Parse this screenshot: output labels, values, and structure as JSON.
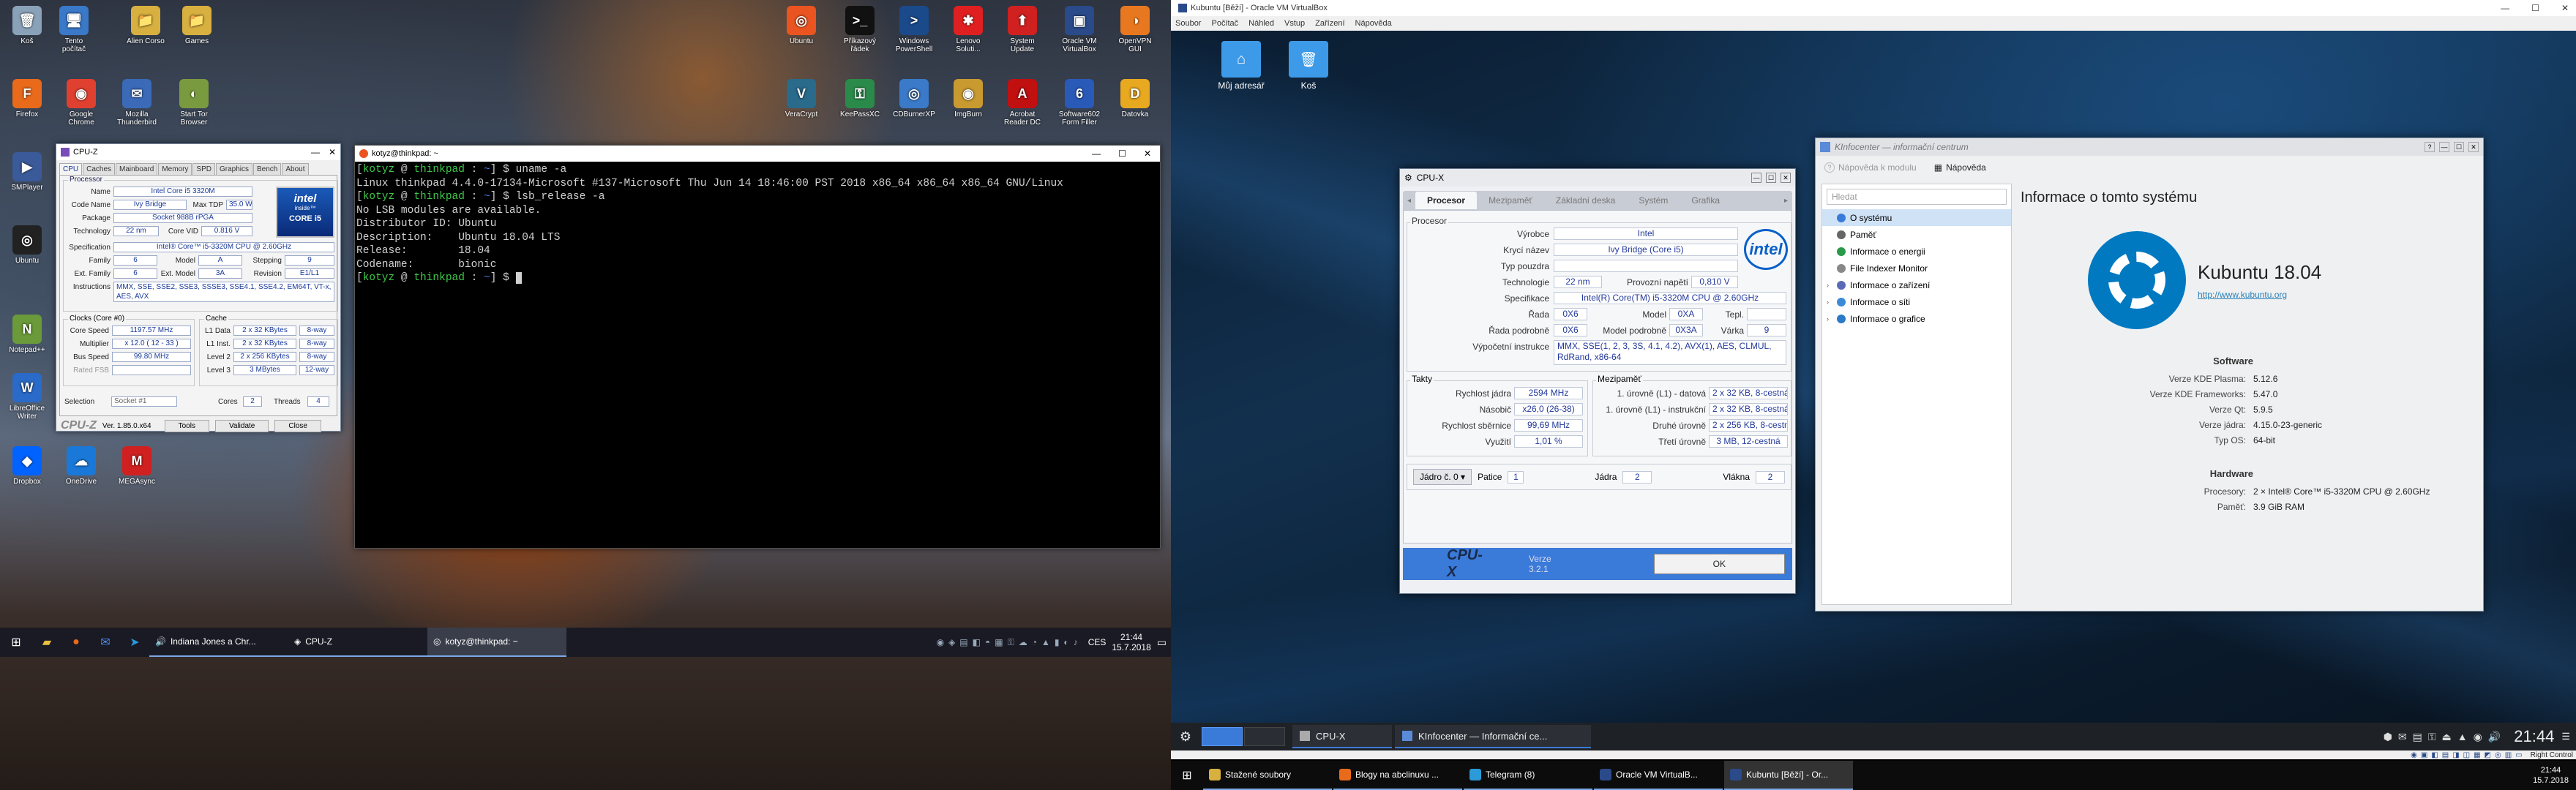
{
  "desktop_left": {
    "icons": [
      {
        "id": "kos",
        "label": "Koš",
        "color": "#8aa2b8",
        "glyph": "🗑"
      },
      {
        "id": "pc",
        "label": "Tento počítač",
        "color": "#3a78c8",
        "glyph": "🖥"
      },
      {
        "id": "alien",
        "label": "Alien Corso",
        "color": "#d8b040",
        "glyph": "📁"
      },
      {
        "id": "games",
        "label": "Games",
        "color": "#d8b040",
        "glyph": "📁"
      },
      {
        "id": "firefox",
        "label": "Firefox",
        "color": "#e86a1a",
        "glyph": "F"
      },
      {
        "id": "chrome",
        "label": "Google Chrome",
        "color": "#e04030",
        "glyph": "◉"
      },
      {
        "id": "tbird",
        "label": "Mozilla Thunderbird",
        "color": "#3a6ab8",
        "glyph": "✉"
      },
      {
        "id": "tor",
        "label": "Start Tor Browser",
        "color": "#7a9a40",
        "glyph": "◐"
      },
      {
        "id": "smp",
        "label": "SMPlayer",
        "color": "#3a5a9a",
        "glyph": "▶"
      },
      {
        "id": "ubuntu1",
        "label": "Ubuntu",
        "color": "#222",
        "glyph": "◎"
      },
      {
        "id": "notepad",
        "label": "Notepad++",
        "color": "#6a9a3a",
        "glyph": "N"
      },
      {
        "id": "libre",
        "label": "LibreOffice Writer",
        "color": "#2a6ac8",
        "glyph": "W"
      },
      {
        "id": "dropbox",
        "label": "Dropbox",
        "color": "#0062ff",
        "glyph": "◆"
      },
      {
        "id": "onedrive",
        "label": "OneDrive",
        "color": "#1a78d8",
        "glyph": "☁"
      },
      {
        "id": "mega",
        "label": "MEGAsync",
        "color": "#d02020",
        "glyph": "M"
      },
      {
        "id": "ubuntu2",
        "label": "Ubuntu",
        "color": "#e95420",
        "glyph": "◎"
      },
      {
        "id": "cmd",
        "label": "Příkazový řádek",
        "color": "#111",
        "glyph": ">_"
      },
      {
        "id": "pwsh",
        "label": "Windows PowerShell",
        "color": "#1a4a8a",
        "glyph": ">"
      },
      {
        "id": "lenovo",
        "label": "Lenovo Soluti...",
        "color": "#e02020",
        "glyph": "✱"
      },
      {
        "id": "sysup",
        "label": "System Update",
        "color": "#d02020",
        "glyph": "⬆"
      },
      {
        "id": "vbox",
        "label": "Oracle VM VirtualBox",
        "color": "#2a4a8a",
        "glyph": "▣"
      },
      {
        "id": "ovpn",
        "label": "OpenVPN GUI",
        "color": "#e87820",
        "glyph": "◑"
      },
      {
        "id": "veracrypt",
        "label": "VeraCrypt",
        "color": "#2a6a8a",
        "glyph": "V"
      },
      {
        "id": "keepass",
        "label": "KeePassXC",
        "color": "#2a8a4a",
        "glyph": "⚿"
      },
      {
        "id": "cdburner",
        "label": "CDBurnerXP",
        "color": "#3a7ac8",
        "glyph": "◎"
      },
      {
        "id": "imgburn",
        "label": "ImgBurn",
        "color": "#c89a30",
        "glyph": "◉"
      },
      {
        "id": "acrobat",
        "label": "Acrobat Reader DC",
        "color": "#c01010",
        "glyph": "A"
      },
      {
        "id": "s602",
        "label": "Software602 Form Filler",
        "color": "#2a5ab8",
        "glyph": "6"
      },
      {
        "id": "datovka",
        "label": "Datovka",
        "color": "#e8a820",
        "glyph": "D"
      }
    ],
    "taskbar": {
      "items": [
        {
          "label": "Indiana Jones a Chr...",
          "glyph": "🔊"
        },
        {
          "label": "CPU-Z",
          "glyph": "◈"
        },
        {
          "label": "kotyz@thinkpad: ~",
          "glyph": "◎"
        }
      ],
      "lang": "CES",
      "time": "21:44",
      "date": "15.7.2018"
    }
  },
  "cpuz_win": {
    "title": "CPU-Z",
    "tabs": [
      "CPU",
      "Caches",
      "Mainboard",
      "Memory",
      "SPD",
      "Graphics",
      "Bench",
      "About"
    ],
    "group_processor": "Processor",
    "name_lbl": "Name",
    "name": "Intel Core i5 3320M",
    "codename_lbl": "Code Name",
    "codename": "Ivy Bridge",
    "maxtdp_lbl": "Max TDP",
    "maxtdp": "35.0 W",
    "package_lbl": "Package",
    "package": "Socket 988B rPGA",
    "tech_lbl": "Technology",
    "tech": "22 nm",
    "corevid_lbl": "Core VID",
    "corevid": "0.816 V",
    "spec_lbl": "Specification",
    "spec": "Intel® Core™ i5-3320M CPU @ 2.60GHz",
    "family_lbl": "Family",
    "family": "6",
    "model_lbl": "Model",
    "model": "A",
    "stepping_lbl": "Stepping",
    "stepping": "9",
    "extfam_lbl": "Ext. Family",
    "extfam": "6",
    "extmodel_lbl": "Ext. Model",
    "extmodel": "3A",
    "rev_lbl": "Revision",
    "rev": "E1/L1",
    "instr_lbl": "Instructions",
    "instr": "MMX, SSE, SSE2, SSE3, SSSE3, SSE4.1, SSE4.2, EM64T, VT-x, AES, AVX",
    "clocks_title": "Clocks (Core #0)",
    "corespeed_lbl": "Core Speed",
    "corespeed": "1197.57 MHz",
    "mult_lbl": "Multiplier",
    "mult": "x 12.0 ( 12 - 33 )",
    "bus_lbl": "Bus Speed",
    "bus": "99.80 MHz",
    "fsb_lbl": "Rated FSB",
    "fsb": "",
    "cache_title": "Cache",
    "l1d_lbl": "L1 Data",
    "l1d": "2 x 32 KBytes",
    "l1d_w": "8-way",
    "l1i_lbl": "L1 Inst.",
    "l1i": "2 x 32 KBytes",
    "l1i_w": "8-way",
    "l2_lbl": "Level 2",
    "l2": "2 x 256 KBytes",
    "l2_w": "8-way",
    "l3_lbl": "Level 3",
    "l3": "3 MBytes",
    "l3_w": "12-way",
    "sel_lbl": "Selection",
    "sel": "Socket #1",
    "cores_lbl": "Cores",
    "cores": "2",
    "threads_lbl": "Threads",
    "threads": "4",
    "brand": "CPU-Z",
    "ver": "Ver. 1.85.0.x64",
    "tools": "Tools",
    "validate": "Validate",
    "close": "Close",
    "logo_intel": "intel",
    "logo_inside": "inside™",
    "logo_core": "CORE i5"
  },
  "terminal": {
    "title": "kotyz@thinkpad: ~",
    "user": "kotyz",
    "at": " @ ",
    "host": "thinkpad",
    "sep": " : ",
    "dir": "~",
    "prompt_end": "] $ ",
    "cmd1": "uname -a",
    "out1": "Linux thinkpad 4.4.0-17134-Microsoft #137-Microsoft Thu Jun 14 18:46:00 PST 2018 x86_64 x86_64 x86_64 GNU/Linux",
    "cmd2": "lsb_release -a",
    "out2": "No LSB modules are available.",
    "out3": "Distributor ID: Ubuntu",
    "out4": "Description:    Ubuntu 18.04 LTS",
    "out5": "Release:        18.04",
    "out6": "Codename:       bionic"
  },
  "vbox": {
    "title": "Kubuntu [Běží] - Oracle VM VirtualBox",
    "menu": [
      "Soubor",
      "Počítač",
      "Náhled",
      "Vstup",
      "Zařízení",
      "Nápověda"
    ]
  },
  "kde_desktop": {
    "icons": [
      {
        "label": "Můj adresář"
      },
      {
        "label": "Koš"
      }
    ]
  },
  "kcpux": {
    "title": "CPU-X",
    "tabs": [
      "Procesor",
      "Mezipaměť",
      "Základní deska",
      "Systém",
      "Grafika"
    ],
    "group_proc": "Procesor",
    "vyrobce_lbl": "Výrobce",
    "vyrobce": "Intel",
    "kryci_lbl": "Krycí název",
    "kryci": "Ivy Bridge (Core i5)",
    "typ_lbl": "Typ pouzdra",
    "typ": "",
    "tech_lbl": "Technologie",
    "tech": "22 nm",
    "napeti_lbl": "Provozní napětí",
    "napeti": "0,810 V",
    "spec_lbl": "Specifikace",
    "spec": "Intel(R) Core(TM) i5-3320M CPU @ 2.60GHz",
    "rada_lbl": "Řada",
    "rada": "0X6",
    "model_lbl": "Model",
    "model": "0XA",
    "tepl_lbl": "Tepl.",
    "tepl": "",
    "radap_lbl": "Řada podrobně",
    "radap": "0X6",
    "modelp_lbl": "Model podrobně",
    "modelp": "0X3A",
    "varka_lbl": "Várka",
    "varka": "9",
    "instr_lbl": "Výpočetní instrukce",
    "instr": "MMX, SSE(1, 2, 3, 3S, 4.1, 4.2), AVX(1), AES, CLMUL, RdRand, x86-64",
    "group_takty": "Takty",
    "rychlost_lbl": "Rychlost jádra",
    "rychlost": "2594 MHz",
    "nasobic_lbl": "Násobič",
    "nasobic": "x26,0 (26-38)",
    "sbernice_lbl": "Rychlost sběrnice",
    "sbernice": "99,69 MHz",
    "vyuziti_lbl": "Využití",
    "vyuziti": "1,01 %",
    "group_cache": "Mezipaměť",
    "l1d_lbl": "1. úrovně (L1) - datová",
    "l1d": "2 x 32 KB, 8-cestná",
    "l1i_lbl": "1. úrovně (L1) - instrukční",
    "l1i": "2 x 32 KB, 8-cestná",
    "l2_lbl": "Druhé úrovně",
    "l2": "2 x 256 KB, 8-cestná",
    "l3_lbl": "Třetí úrovně",
    "l3": "3 MB, 12-cestná",
    "core_sel": "Jádro č. 0",
    "patice_lbl": "Patice",
    "patice": "1",
    "jadra_lbl": "Jádra",
    "jadra": "2",
    "vlakna_lbl": "Vlákna",
    "vlakna": "2",
    "brand": "CPU-X",
    "ver": "Verze 3.2.1",
    "ok": "OK",
    "logo": "intel"
  },
  "kinfo": {
    "title": "KInfocenter — informační centrum",
    "help_module": "Nápověda k modulu",
    "help": "Nápověda",
    "search_placeholder": "Hledat",
    "tree": [
      "O systému",
      "Paměť",
      "Informace o energii",
      "File Indexer Monitor",
      "Informace o zařízení",
      "Informace o síti",
      "Informace o grafice"
    ],
    "heading": "Informace o tomto systému",
    "distro": "Kubuntu 18.04",
    "url": "http://www.kubuntu.org",
    "sw_title": "Software",
    "sw": [
      {
        "k": "Verze KDE Plasma:",
        "v": "5.12.6"
      },
      {
        "k": "Verze KDE Frameworks:",
        "v": "5.47.0"
      },
      {
        "k": "Verze Qt:",
        "v": "5.9.5"
      },
      {
        "k": "Verze jádra:",
        "v": "4.15.0-23-generic"
      },
      {
        "k": "Typ OS:",
        "v": "64-bit"
      }
    ],
    "hw_title": "Hardware",
    "hw": [
      {
        "k": "Procesory:",
        "v": "2 × Intel® Core™ i5-3320M CPU @ 2.60GHz"
      },
      {
        "k": "Paměť:",
        "v": "3.9 GiB RAM"
      }
    ]
  },
  "kde_panel": {
    "tasks": [
      {
        "label": "CPU-X"
      },
      {
        "label": "KInfocenter — Informační ce..."
      }
    ],
    "time": "21:44"
  },
  "vbox_status": {
    "host_key": "Right Control"
  },
  "taskbar_right": {
    "items": [
      {
        "label": "Stažené soubory",
        "color": "#d8b040"
      },
      {
        "label": "Blogy na abclinuxu ...",
        "color": "#e86a1a"
      },
      {
        "label": "Telegram (8)",
        "color": "#2a9ad8"
      },
      {
        "label": "Oracle VM VirtualB...",
        "color": "#2a4a8a"
      },
      {
        "label": "Kubuntu [Běží] - Or...",
        "color": "#2a4a8a"
      }
    ],
    "time": "21:44",
    "date": "15.7.2018"
  }
}
